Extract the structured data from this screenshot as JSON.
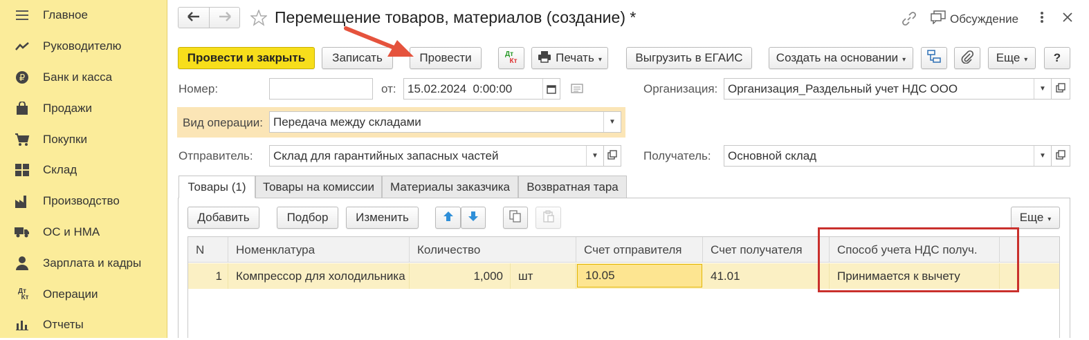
{
  "sidebar": {
    "items": [
      {
        "label": "Главное",
        "icon": "menu-lines-icon"
      },
      {
        "label": "Руководителю",
        "icon": "trend-icon"
      },
      {
        "label": "Банк и касса",
        "icon": "ruble-coin-icon"
      },
      {
        "label": "Продажи",
        "icon": "shopping-bag-icon"
      },
      {
        "label": "Покупки",
        "icon": "cart-icon"
      },
      {
        "label": "Склад",
        "icon": "warehouse-icon"
      },
      {
        "label": "Производство",
        "icon": "factory-icon"
      },
      {
        "label": "ОС и НМА",
        "icon": "truck-icon"
      },
      {
        "label": "Зарплата и кадры",
        "icon": "person-icon"
      },
      {
        "label": "Операции",
        "icon": "dt-kt-icon"
      },
      {
        "label": "Отчеты",
        "icon": "bar-chart-icon"
      }
    ]
  },
  "header": {
    "title": "Перемещение товаров, материалов (создание) *",
    "discussion_label": "Обсуждение"
  },
  "toolbar": {
    "post_close": "Провести и закрыть",
    "save": "Записать",
    "post": "Провести",
    "dtkt_top": "Дт",
    "dtkt_bottom": "Кт",
    "print": "Печать",
    "egais": "Выгрузить в ЕГАИС",
    "create_based": "Создать на основании",
    "more": "Еще",
    "help": "?"
  },
  "form": {
    "number_label": "Номер:",
    "number_value": "",
    "date_label": "от:",
    "date_value": "15.02.2024  0:00:00",
    "org_label": "Организация:",
    "org_value": "Организация_Раздельный учет НДС ООО",
    "op_label": "Вид операции:",
    "op_value": "Передача между складами",
    "sender_label": "Отправитель:",
    "sender_value": "Склад для гарантийных запасных частей",
    "receiver_label": "Получатель:",
    "receiver_value": "Основной склад"
  },
  "tabs": [
    {
      "label": "Товары (1)"
    },
    {
      "label": "Товары на комиссии"
    },
    {
      "label": "Материалы заказчика"
    },
    {
      "label": "Возвратная тара"
    }
  ],
  "table_toolbar": {
    "add": "Добавить",
    "pick": "Подбор",
    "edit": "Изменить",
    "more": "Еще"
  },
  "table": {
    "columns": [
      "N",
      "Номенклатура",
      "Количество",
      "Счет отправителя",
      "Счет получателя",
      "Способ учета НДС получ."
    ],
    "rows": [
      {
        "n": "1",
        "item": "Компрессор для холодильника",
        "qty": "1,000",
        "unit": "шт",
        "acc_from": "10.05",
        "acc_to": "41.01",
        "vat": "Принимается к вычету"
      }
    ]
  },
  "colors": {
    "sidebar_bg": "#fbec9a",
    "primary_button": "#f7de1b",
    "highlight_box": "#c9302c",
    "arrow": "#e5533d"
  }
}
